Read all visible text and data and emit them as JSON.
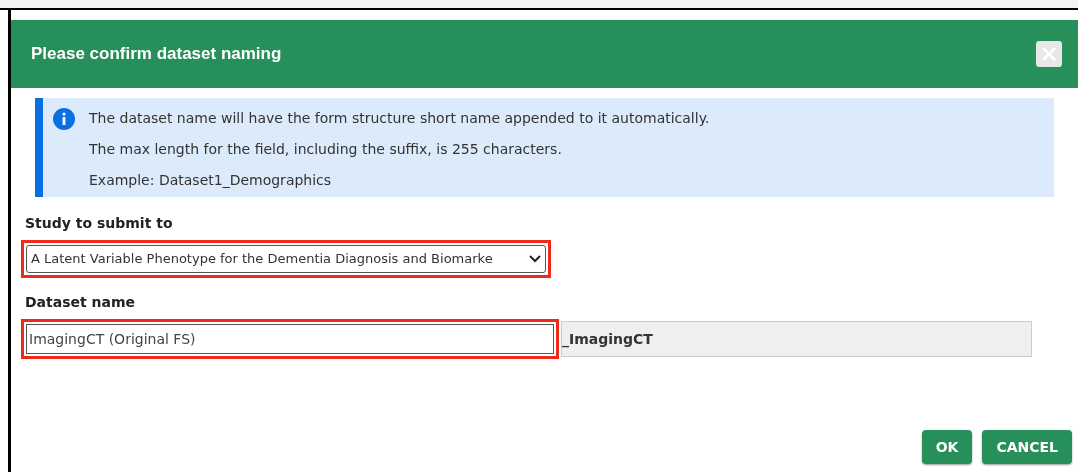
{
  "dialog": {
    "title": "Please confirm dataset naming"
  },
  "info": {
    "lines": [
      "The dataset name will have the form structure short name appended to it automatically.",
      "The max length for the field, including the suffix, is 255 characters.",
      "Example: Dataset1_Demographics"
    ]
  },
  "study": {
    "label": "Study to submit to",
    "value": "A Latent Variable Phenotype for the Dementia Diagnosis and Biomarke",
    "highlighted": true
  },
  "dataset": {
    "label": "Dataset name",
    "value": "ImagingCT (Original FS)",
    "suffix": "_ImagingCT",
    "highlighted": true
  },
  "buttons": [
    "OK",
    "CANCEL"
  ]
}
